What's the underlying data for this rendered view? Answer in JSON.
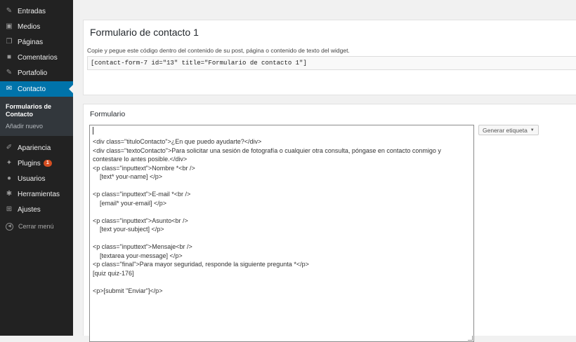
{
  "sidebar": {
    "items": [
      {
        "name": "entradas",
        "label": "Entradas",
        "icon": "pushpin-icon",
        "glyph": "✎"
      },
      {
        "name": "medios",
        "label": "Medios",
        "icon": "media-icon",
        "glyph": "▣"
      },
      {
        "name": "paginas",
        "label": "Páginas",
        "icon": "page-icon",
        "glyph": "❐"
      },
      {
        "name": "comentarios",
        "label": "Comentarios",
        "icon": "comment-icon",
        "glyph": "■"
      },
      {
        "name": "portafolio",
        "label": "Portafolio",
        "icon": "pushpin-icon",
        "glyph": "✎"
      },
      {
        "name": "contacto",
        "label": "Contacto",
        "icon": "mail-icon",
        "glyph": "✉",
        "active": true
      },
      {
        "name": "apariencia",
        "label": "Apariencia",
        "icon": "brush-icon",
        "glyph": "✐"
      },
      {
        "name": "plugins",
        "label": "Plugins",
        "icon": "plugin-icon",
        "glyph": "✦",
        "badge": "1"
      },
      {
        "name": "usuarios",
        "label": "Usuarios",
        "icon": "user-icon",
        "glyph": "●"
      },
      {
        "name": "herramientas",
        "label": "Herramientas",
        "icon": "wrench-icon",
        "glyph": "✱"
      },
      {
        "name": "ajustes",
        "label": "Ajustes",
        "icon": "settings-icon",
        "glyph": "⊞"
      }
    ],
    "submenu": {
      "current": "Formularios de Contacto",
      "add_new": "Añadir nuevo"
    },
    "collapse_label": "Cerrar menú"
  },
  "header_panel": {
    "title": "Formulario de contacto 1",
    "instructions": "Copie y pegue este código dentro del contenido de su post, página o contenido de texto del widget.",
    "shortcode": "[contact-form-7 id=\"13\" title=\"Formulario de contacto 1\"]"
  },
  "form_panel": {
    "section_label": "Formulario",
    "tag_generator_label": "Generar etiqueta",
    "editor_lines": [
      "<div class=\"tituloContacto\">¿En que puedo ayudarte?</div>",
      "<div class=\"textoContacto\">Para solicitar una sesión de fotografía o cualquier otra consulta, póngase en contacto conmigo y contestare lo antes posible.</div>",
      "<p class=\"inputtext\">Nombre *<br />",
      "    [text* your-name] </p>",
      "",
      "<p class=\"inputtext\">E-mail *<br />",
      "    [email* your-email] </p>",
      "",
      "<p class=\"inputtext\">Asunto<br />",
      "    [text your-subject] </p>",
      "",
      "<p class=\"inputtext\">Mensaje<br />",
      "    [textarea your-message] </p>",
      "<p class=\"final\">Para mayor seguridad, responde la siguiente pregunta *</p>",
      "[quiz quiz-176]",
      "",
      "<p>[submit \"Enviar\"]</p>"
    ]
  },
  "colors": {
    "sidebar_bg": "#222222",
    "active_bg": "#0073aa",
    "badge_bg": "#d54e21"
  }
}
